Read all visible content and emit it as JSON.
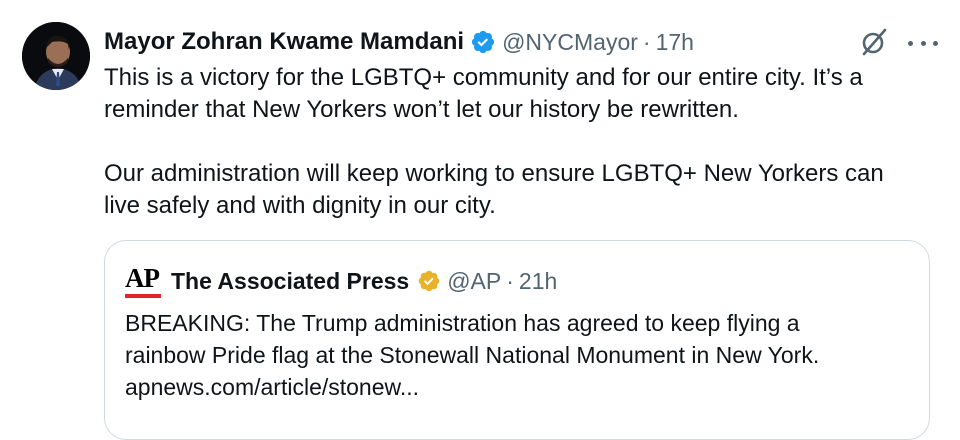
{
  "tweet": {
    "display_name": "Mayor Zohran Kwame Mamdani",
    "handle": "@NYCMayor",
    "separator": "·",
    "time": "17h",
    "paragraphs": [
      "This is a victory for the LGBTQ+ community and for our entire city. It’s a reminder that New Yorkers won’t let our history be rewritten.",
      "Our administration will keep working to ensure LGBTQ+ New Yorkers can live safely and with dignity in our city."
    ],
    "icons": {
      "verified": "verified-badge-icon",
      "grok": "grok-icon",
      "more": "more-options-icon"
    },
    "colors": {
      "verified_blue": "#1d9bf0",
      "text": "#0f1419",
      "muted": "#536471"
    }
  },
  "quote": {
    "logo_text": "AP",
    "display_name": "The Associated Press",
    "handle": "@AP",
    "separator": "·",
    "time": "21h",
    "text_lines": [
      "BREAKING: The Trump administration has agreed to keep flying a",
      "rainbow Pride flag at the Stonewall National Monument in New York.",
      "apnews.com/article/stonew..."
    ],
    "colors": {
      "gold_badge": "#e8b32a",
      "ap_red": "#e0262b",
      "border": "#cfd9de"
    }
  }
}
